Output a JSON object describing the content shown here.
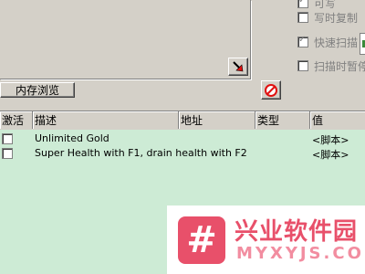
{
  "options": [
    {
      "label": "可写",
      "checked": true
    },
    {
      "label": "写时复制",
      "checked": false
    },
    {
      "label": "快速扫描",
      "checked": true
    },
    {
      "label": "扫描时暂停",
      "checked": false
    }
  ],
  "buttons": {
    "memory_browse": "内存浏览",
    "arrow_icon": "red-arrow-icon",
    "clear_icon": "no-entry-icon"
  },
  "table": {
    "headers": [
      "激活",
      "描述",
      "地址",
      "类型",
      "值"
    ],
    "rows": [
      {
        "active": false,
        "description": "Unlimited Gold",
        "address": "",
        "type": "",
        "value": "<脚本>"
      },
      {
        "active": false,
        "description": "Super Health with F1, drain health with F2",
        "address": "",
        "type": "",
        "value": "<脚本>"
      }
    ]
  },
  "watermark": {
    "logo_char": "#",
    "title": "兴业软件园",
    "subtitle": "MYXYJS.COM"
  },
  "colors": {
    "list_background": "#cdebd5",
    "accent_red": "#e01010",
    "watermark_pink": "#e8506a"
  }
}
